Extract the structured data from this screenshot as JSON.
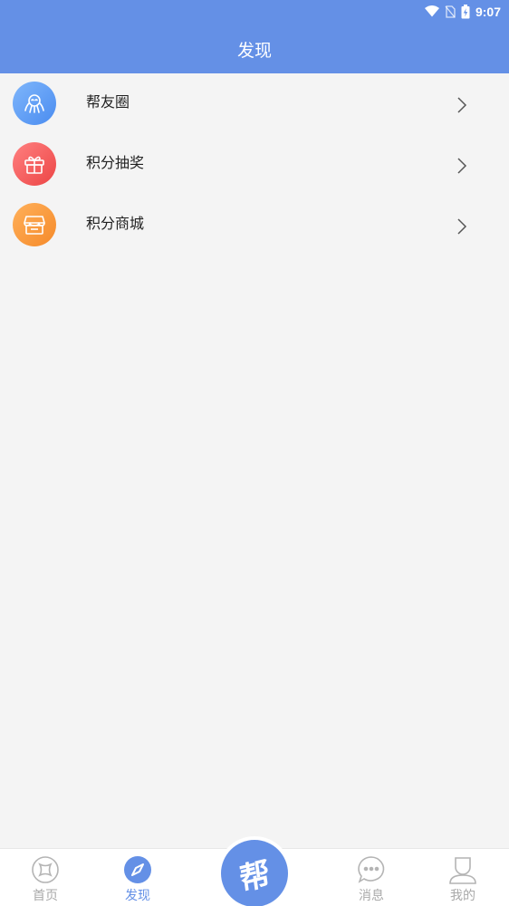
{
  "status_bar": {
    "time": "9:07",
    "icons": [
      "wifi-icon",
      "no-sim-icon",
      "battery-charging-icon"
    ]
  },
  "header": {
    "title": "发现"
  },
  "list": {
    "items": [
      {
        "label": "帮友圈",
        "icon": "friends-circle-icon",
        "color": "#5b9ff5"
      },
      {
        "label": "积分抽奖",
        "icon": "gift-icon",
        "color": "#f55a5a"
      },
      {
        "label": "积分商城",
        "icon": "store-icon",
        "color": "#f79a3e"
      }
    ]
  },
  "bottom_nav": {
    "tabs": [
      {
        "label": "首页",
        "icon": "home-icon",
        "active": false
      },
      {
        "label": "发现",
        "icon": "compass-icon",
        "active": true
      },
      {
        "label": "消息",
        "icon": "message-icon",
        "active": false
      },
      {
        "label": "我的",
        "icon": "profile-icon",
        "active": false
      }
    ],
    "center_button": {
      "label": "帮",
      "icon": "help-logo-icon"
    }
  },
  "colors": {
    "primary": "#6490e6",
    "inactive": "#a9a9a9",
    "background": "#f4f4f4"
  }
}
